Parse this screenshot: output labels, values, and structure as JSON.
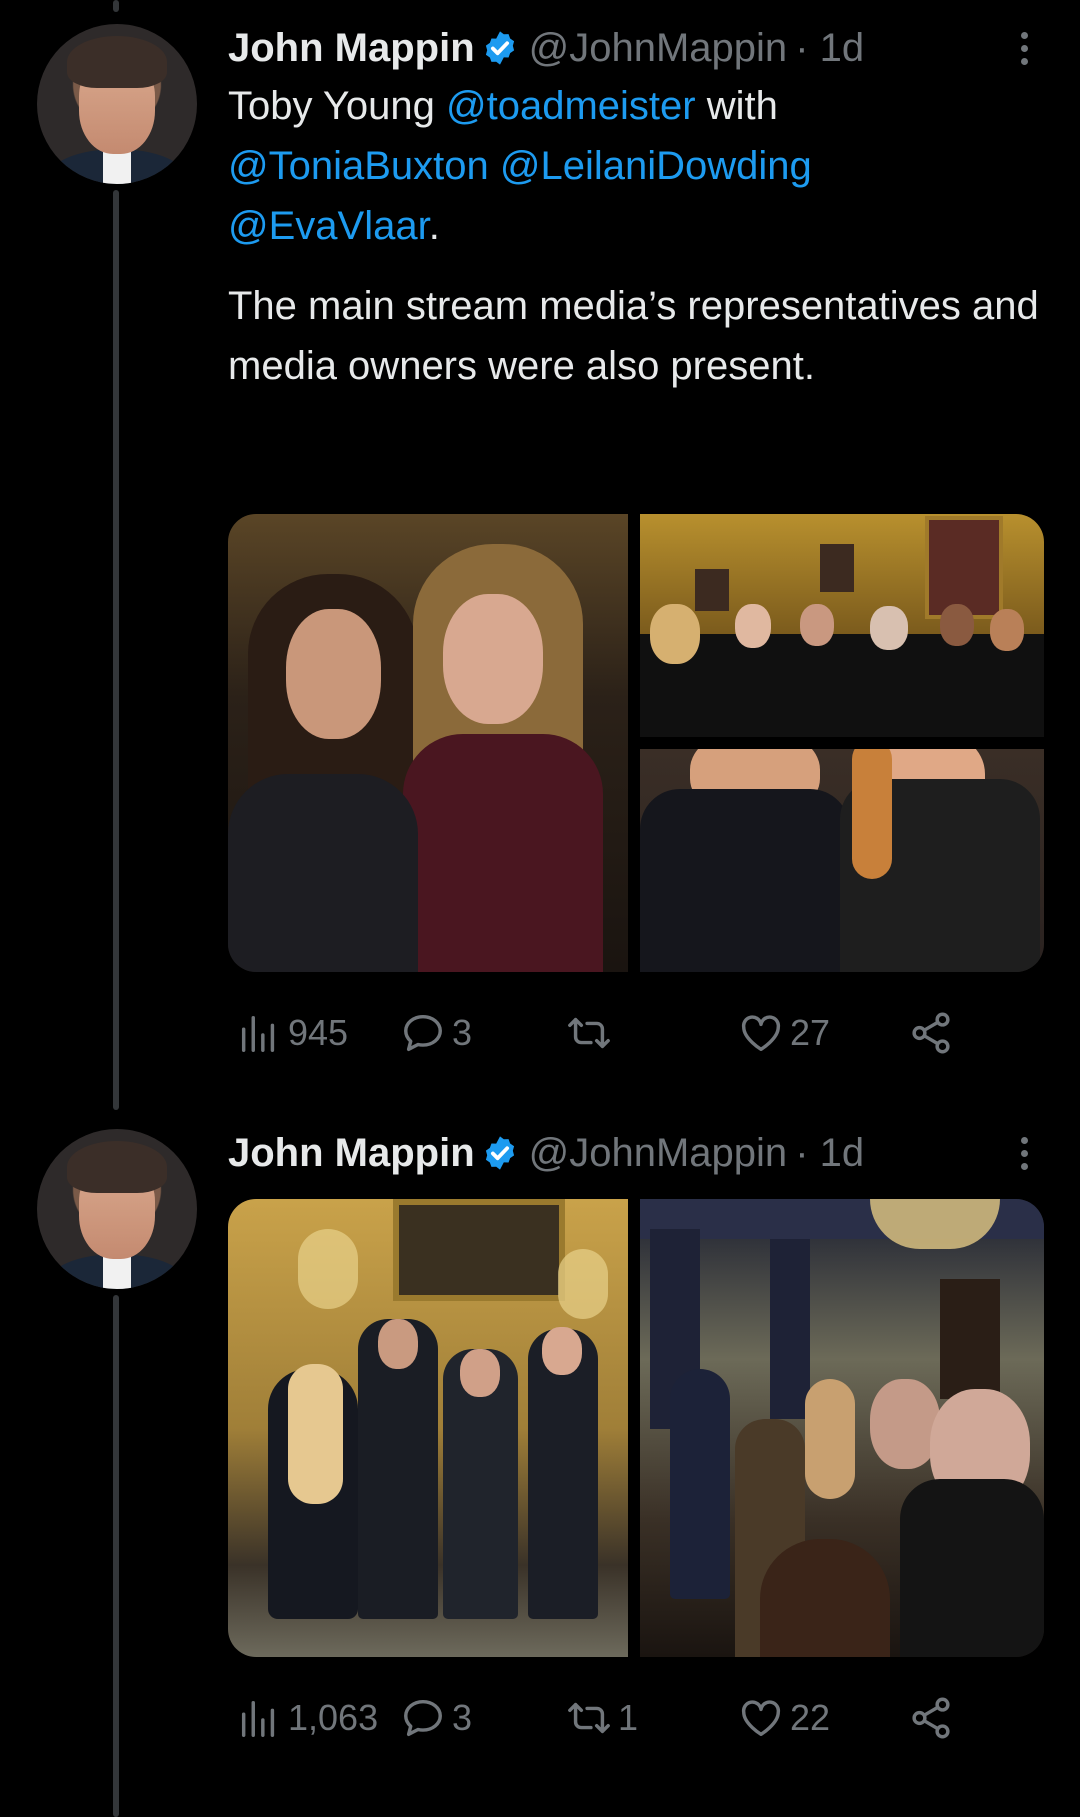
{
  "tweets": [
    {
      "author_name": "John Mappin",
      "handle": "@JohnMappin",
      "time": "· 1d",
      "text_parts": [
        "Toby Young ",
        "@toadmeister",
        " with",
        "@ToniaBuxton",
        " ",
        "@LeilaniDowding",
        "@EvaVlaar",
        "."
      ],
      "text_body": "The main stream media’s representatives and media owners were also present.",
      "stats": {
        "views": "945",
        "replies": "3",
        "retweets": "",
        "likes": "27"
      }
    },
    {
      "author_name": "John Mappin",
      "handle": "@JohnMappin",
      "time": "· 1d",
      "stats": {
        "views": "1,063",
        "replies": "3",
        "retweets": "1",
        "likes": "22"
      }
    }
  ],
  "icons": {
    "verified": "verified-badge-icon",
    "more": "more-options-icon",
    "views": "views-icon",
    "reply": "reply-icon",
    "retweet": "retweet-icon",
    "like": "like-icon",
    "share": "share-icon"
  },
  "colors": {
    "background": "#000000",
    "accent": "#1d9bf0",
    "muted": "#71767b",
    "text": "#e7e9ea"
  }
}
